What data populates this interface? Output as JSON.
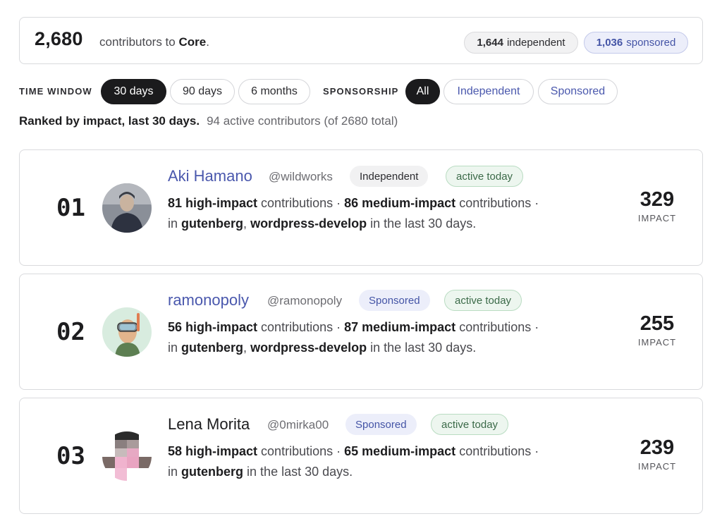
{
  "summary": {
    "total": "2,680",
    "text_prefix": "contributors to",
    "project": "Core",
    "text_suffix": ".",
    "independent_count": "1,644",
    "independent_label": "independent",
    "sponsored_count": "1,036",
    "sponsored_label": "sponsored"
  },
  "filters": {
    "time_label": "TIME WINDOW",
    "time_options": [
      "30 days",
      "90 days",
      "6 months"
    ],
    "time_selected": "30 days",
    "sponsorship_label": "SPONSORSHIP",
    "sponsorship_options": [
      "All",
      "Independent",
      "Sponsored"
    ],
    "sponsorship_selected": "All"
  },
  "ranking": {
    "heading": "Ranked by impact, last 30 days.",
    "subtext": "94 active contributors (of 2680 total)"
  },
  "contributors": [
    {
      "rank": "01",
      "name": "Aki Hamano",
      "handle": "@wildworks",
      "tag": "Independent",
      "status": "active today",
      "high": "81 high-impact",
      "high_suffix": "contributions ·",
      "medium": "86 medium-impact",
      "medium_suffix": "contributions ·",
      "in": "in",
      "repo1": "gutenberg",
      "sep": ",",
      "repo2": "wordpress-develop",
      "period": "in the last 30 days.",
      "impact": "329",
      "impact_label": "IMPACT"
    },
    {
      "rank": "02",
      "name": "ramonopoly",
      "handle": "@ramonopoly",
      "tag": "Sponsored",
      "status": "active today",
      "high": "56 high-impact",
      "high_suffix": "contributions ·",
      "medium": "87 medium-impact",
      "medium_suffix": "contributions ·",
      "in": "in",
      "repo1": "gutenberg",
      "sep": ",",
      "repo2": "wordpress-develop",
      "period": "in the last 30 days.",
      "impact": "255",
      "impact_label": "IMPACT"
    },
    {
      "rank": "03",
      "name": "Lena Morita",
      "handle": "@0mirka00",
      "tag": "Sponsored",
      "status": "active today",
      "high": "58 high-impact",
      "high_suffix": "contributions ·",
      "medium": "65 medium-impact",
      "medium_suffix": "contributions ·",
      "in": "in",
      "repo1": "gutenberg",
      "period": "in the last 30 days.",
      "impact": "239",
      "impact_label": "IMPACT"
    }
  ],
  "colors": {
    "accent_blue": "#4a58ad",
    "active_green": "#3b6a48",
    "dark_chip": "#1b1b1d"
  }
}
